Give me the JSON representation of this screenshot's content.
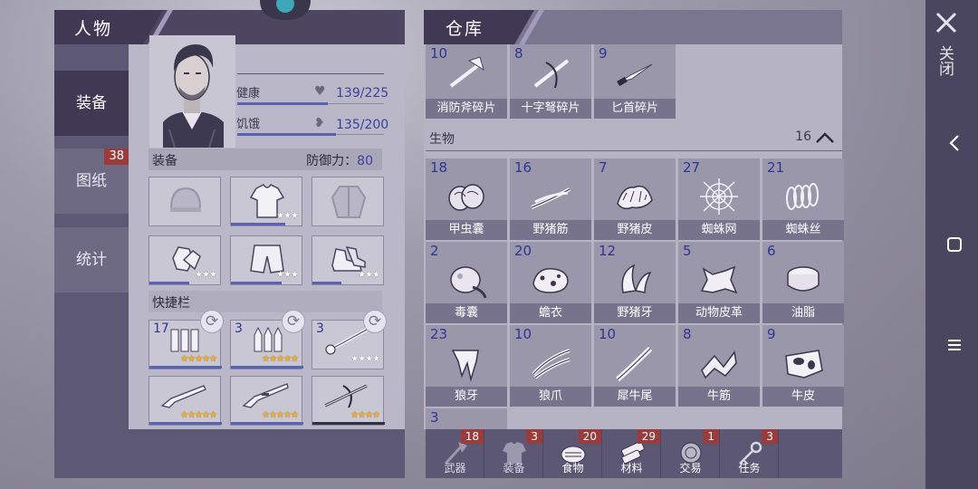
{
  "character_panel": {
    "title": "人物",
    "tabs": [
      {
        "label": "装备",
        "badge": ""
      },
      {
        "label": "图纸",
        "badge": "38"
      },
      {
        "label": "统计",
        "badge": ""
      }
    ],
    "stats": {
      "health": {
        "label": "健康",
        "value": "139/225",
        "fraction": 0.62
      },
      "hunger": {
        "label": "饥饿",
        "value": "135/200",
        "fraction": 0.675
      }
    },
    "equipment": {
      "title": "装备",
      "defense_label": "防御力：",
      "defense_value": "80",
      "slots": [
        {
          "icon": "hat-icon",
          "stars": 0
        },
        {
          "icon": "tshirt-icon",
          "stars": 3,
          "durability": 0.75
        },
        {
          "icon": "jacket-icon",
          "stars": 0
        },
        {
          "icon": "gloves-icon",
          "stars": 3,
          "durability": 0.55
        },
        {
          "icon": "shorts-icon",
          "stars": 3,
          "durability": 0.7
        },
        {
          "icon": "shoes-icon",
          "stars": 3,
          "durability": 0.4
        }
      ]
    },
    "quickbar": {
      "title": "快捷栏",
      "slots": [
        {
          "qty": "17",
          "icon": "bullets-icon",
          "stars": 5
        },
        {
          "qty": "3",
          "icon": "rifle-bullets-icon",
          "stars": 5
        },
        {
          "qty": "3",
          "icon": "arrow-icon",
          "stars": 4
        },
        {
          "qty": "",
          "icon": "shotgun-icon",
          "stars": 5
        },
        {
          "qty": "",
          "icon": "rifle-icon",
          "stars": 5
        },
        {
          "qty": "",
          "icon": "crossbow-icon",
          "stars": 4
        }
      ]
    }
  },
  "warehouse": {
    "title": "仓库",
    "top_items": [
      {
        "qty": "10",
        "name": "消防斧碎片",
        "icon": "axe-icon"
      },
      {
        "qty": "8",
        "name": "十字弩碎片",
        "icon": "crossbow-icon"
      },
      {
        "qty": "9",
        "name": "匕首碎片",
        "icon": "dagger-icon"
      }
    ],
    "category": {
      "name": "生物",
      "count": "16"
    },
    "items": [
      {
        "qty": "18",
        "name": "甲虫囊",
        "icon": "beetle-sac-icon"
      },
      {
        "qty": "16",
        "name": "野猪筋",
        "icon": "sinew-icon"
      },
      {
        "qty": "7",
        "name": "野猪皮",
        "icon": "boar-hide-icon"
      },
      {
        "qty": "27",
        "name": "蜘蛛网",
        "icon": "spiderweb-icon"
      },
      {
        "qty": "21",
        "name": "蜘蛛丝",
        "icon": "silk-icon"
      },
      {
        "qty": "2",
        "name": "毒囊",
        "icon": "poison-sac-icon"
      },
      {
        "qty": "20",
        "name": "蟾衣",
        "icon": "toad-skin-icon"
      },
      {
        "qty": "12",
        "name": "野猪牙",
        "icon": "boar-tusk-icon"
      },
      {
        "qty": "5",
        "name": "动物皮革",
        "icon": "leather-icon"
      },
      {
        "qty": "6",
        "name": "油脂",
        "icon": "fat-icon"
      },
      {
        "qty": "23",
        "name": "狼牙",
        "icon": "wolf-fang-icon"
      },
      {
        "qty": "10",
        "name": "狼爪",
        "icon": "wolf-claw-icon"
      },
      {
        "qty": "10",
        "name": "犀牛尾",
        "icon": "rhino-tail-icon"
      },
      {
        "qty": "8",
        "name": "牛筋",
        "icon": "ox-sinew-icon"
      },
      {
        "qty": "9",
        "name": "牛皮",
        "icon": "cowhide-icon"
      }
    ],
    "partial_item": {
      "qty": "3"
    },
    "nav": [
      {
        "label": "武器",
        "badge": "18",
        "icon": "axe-icon"
      },
      {
        "label": "装备",
        "badge": "3",
        "icon": "shirt-icon"
      },
      {
        "label": "食物",
        "badge": "20",
        "icon": "meat-icon"
      },
      {
        "label": "材料",
        "badge": "29",
        "icon": "bandage-icon"
      },
      {
        "label": "交易",
        "badge": "1",
        "icon": "coin-icon"
      },
      {
        "label": "任务",
        "badge": "3",
        "icon": "key-icon"
      }
    ]
  },
  "close": {
    "label": "关闭",
    "icon": "close-icon"
  },
  "system_bar": [
    "back-icon",
    "home-icon",
    "menu-icon"
  ]
}
